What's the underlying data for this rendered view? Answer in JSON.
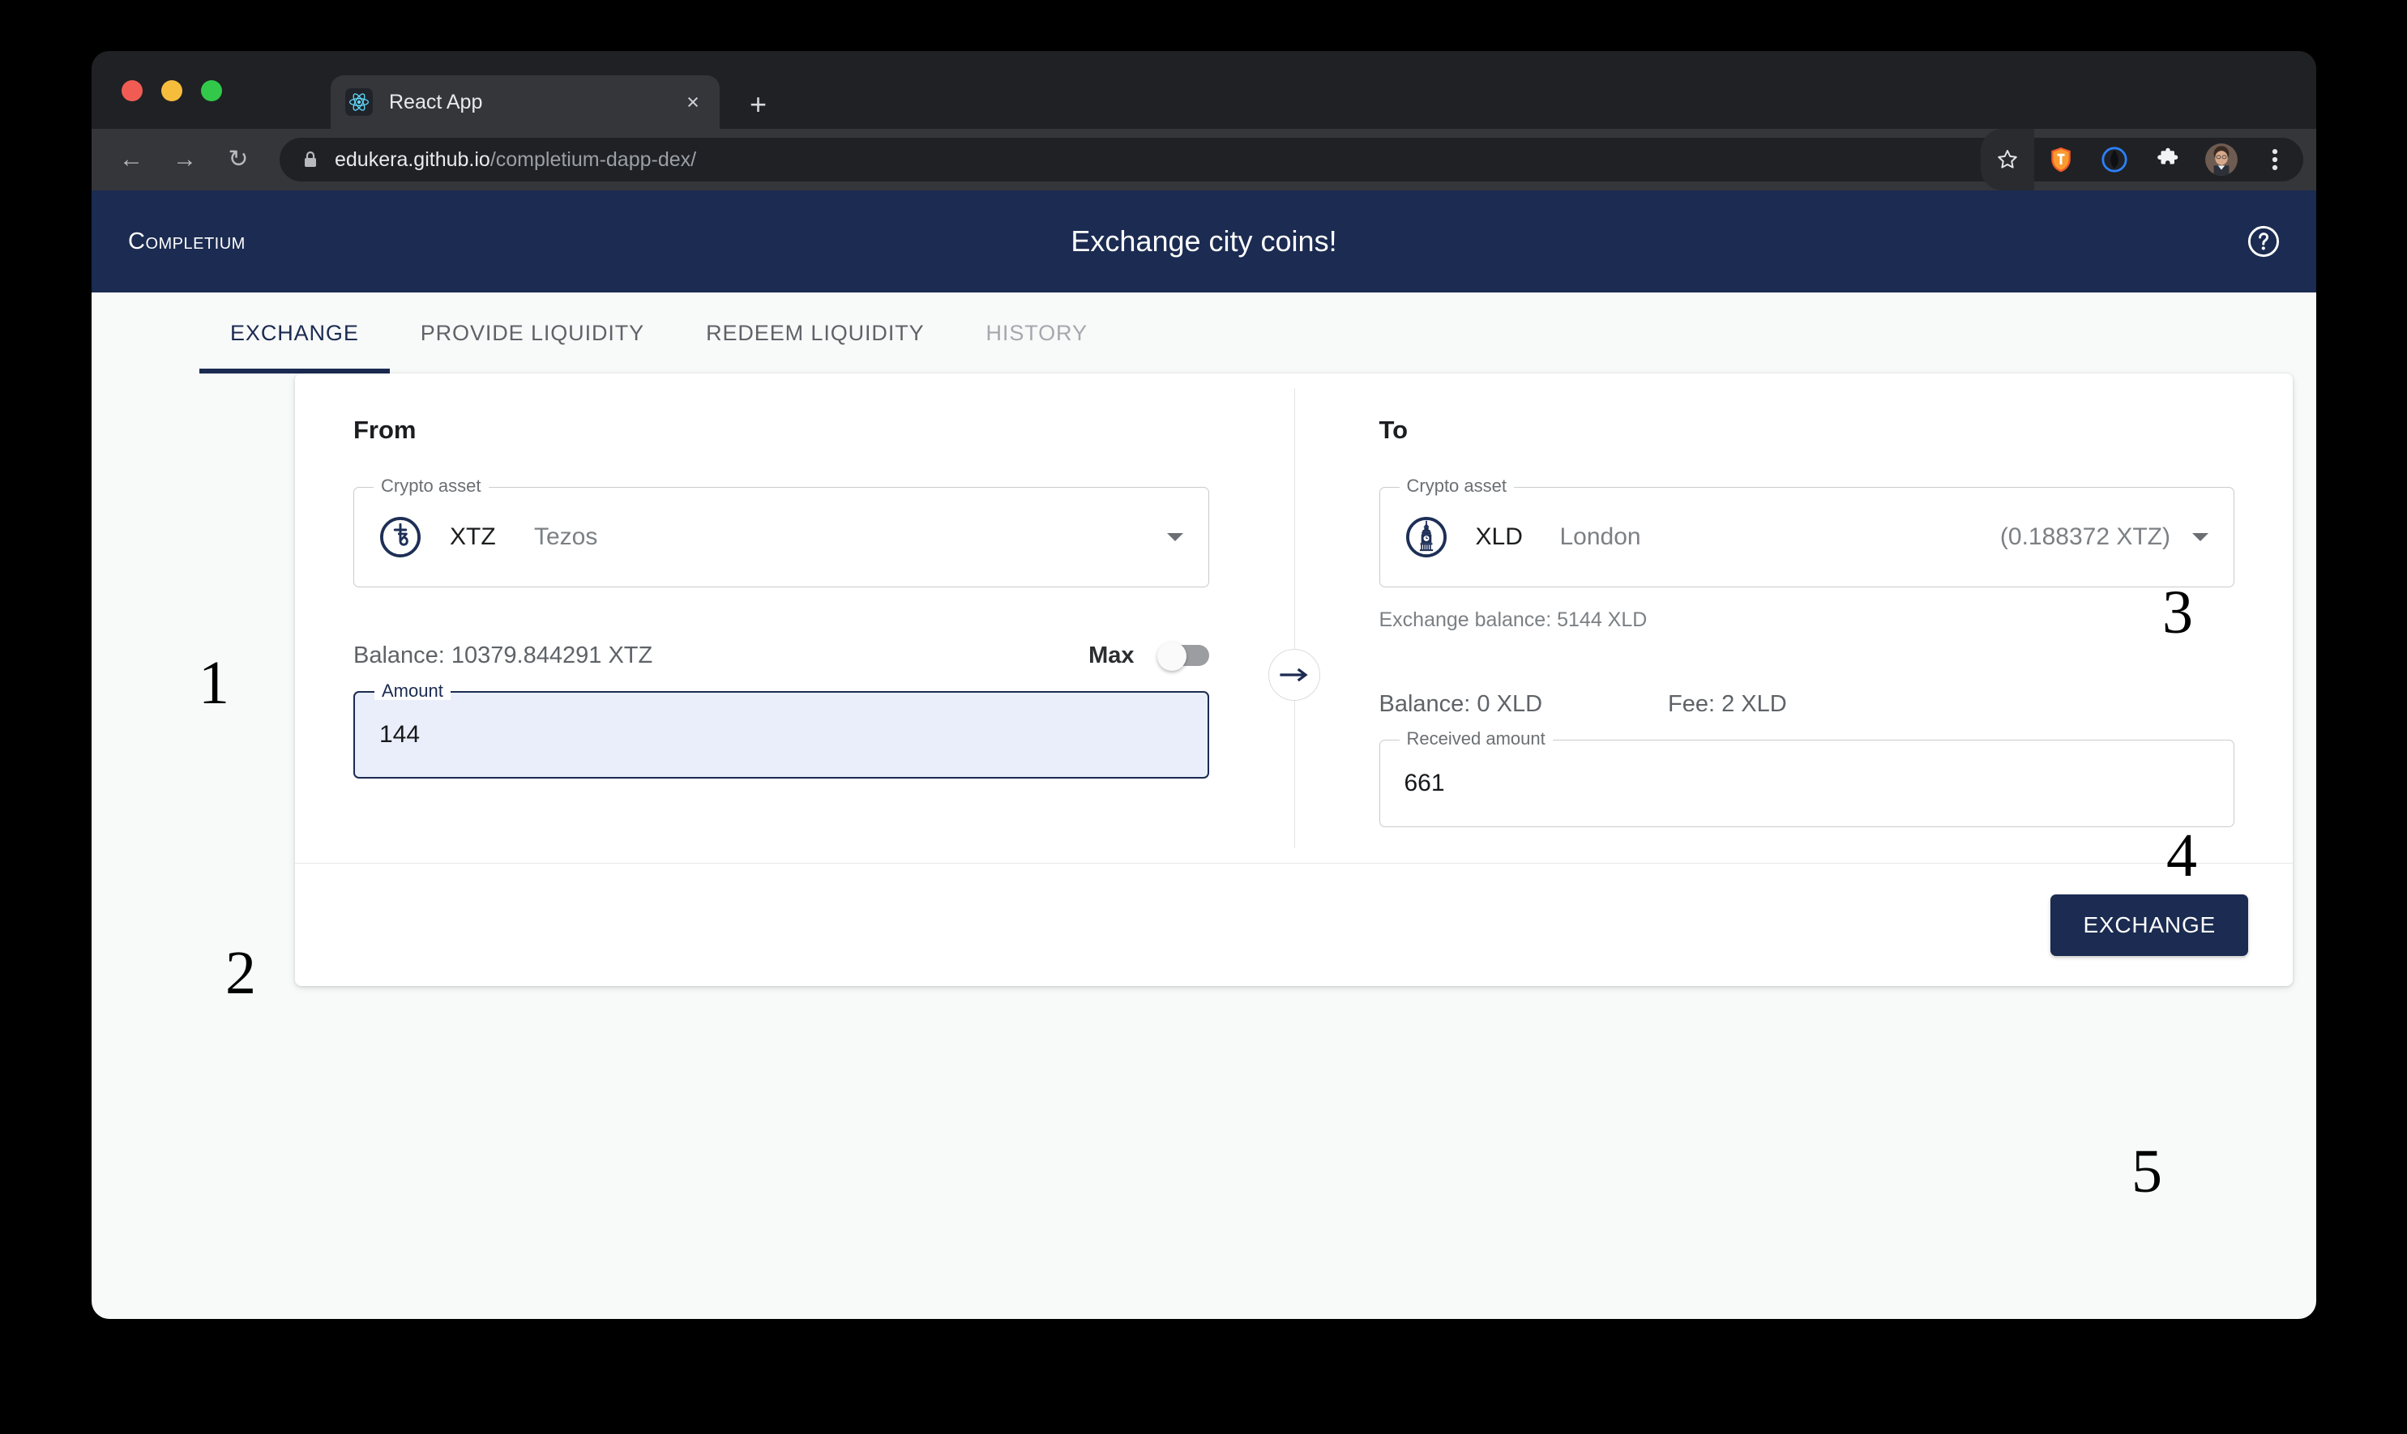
{
  "browser": {
    "tab_title": "React App",
    "tab_close_label": "×",
    "new_tab_label": "+",
    "back_label": "←",
    "forward_label": "→",
    "reload_label": "↻",
    "url_host": "edukera.github.io",
    "url_path": "/completium-dapp-dex/",
    "icons": {
      "favicon": "react-logo-icon",
      "lock": "lock-icon",
      "star": "bookmark-star-icon",
      "shield": "shield-extension-icon",
      "wallet": "temple-wallet-icon",
      "puzzle": "extensions-puzzle-icon",
      "avatar": "profile-avatar-icon",
      "menu": "three-dot-menu-icon"
    }
  },
  "app": {
    "brand": "Completium",
    "title": "Exchange city coins!",
    "help_icon": "help-circle-icon"
  },
  "tabs": [
    {
      "label": "EXCHANGE",
      "state": "active"
    },
    {
      "label": "PROVIDE LIQUIDITY",
      "state": "normal"
    },
    {
      "label": "REDEEM LIQUIDITY",
      "state": "normal"
    },
    {
      "label": "HISTORY",
      "state": "disabled"
    }
  ],
  "from": {
    "label": "From",
    "asset_legend": "Crypto asset",
    "symbol": "XTZ",
    "name": "Tezos",
    "icon": "tezos-coin-icon",
    "caret": "chevron-down-icon",
    "balance": "Balance: 10379.844291 XTZ",
    "max_label": "Max",
    "max_on": false,
    "amount_legend": "Amount",
    "amount_value": "144"
  },
  "swap": {
    "icon": "arrow-right-icon"
  },
  "to": {
    "label": "To",
    "asset_legend": "Crypto asset",
    "symbol": "XLD",
    "name": "London",
    "icon": "big-ben-coin-icon",
    "rate": "(0.188372 XTZ)",
    "caret": "chevron-down-icon",
    "exchange_balance": "Exchange balance: 5144 XLD",
    "balance": "Balance: 0 XLD",
    "fee": "Fee: 2 XLD",
    "received_legend": "Received amount",
    "received_value": "661"
  },
  "footer": {
    "exchange_button": "EXCHANGE"
  },
  "annotations": [
    {
      "label": "1"
    },
    {
      "label": "2"
    },
    {
      "label": "3"
    },
    {
      "label": "4"
    },
    {
      "label": "5"
    }
  ],
  "colors": {
    "navy": "#1b2b51",
    "page_bg": "#f8f9f9",
    "card_bg": "#ffffff",
    "focus_fill": "#e9eefa",
    "muted_text": "#7c8084",
    "browser_chrome": "#35363a"
  }
}
